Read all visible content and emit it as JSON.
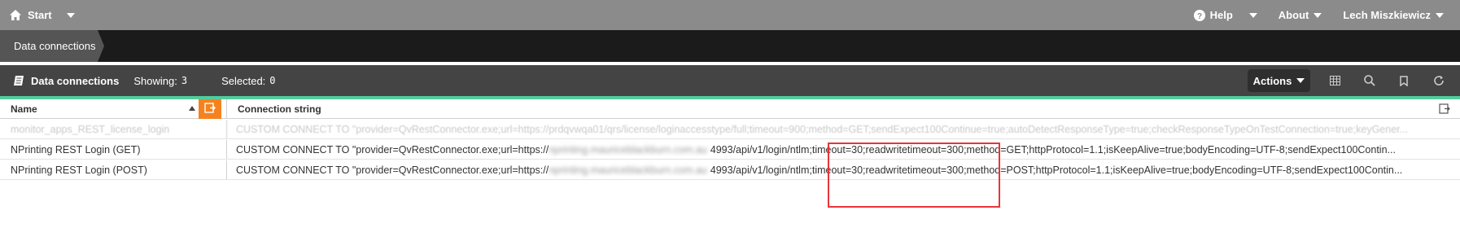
{
  "topbar": {
    "start_label": "Start",
    "help_label": "Help",
    "about_label": "About",
    "user_name": "Lech Miszkiewicz"
  },
  "breadcrumb": {
    "label": "Data connections"
  },
  "toolbar": {
    "title": "Data connections",
    "showing_label": "Showing:",
    "showing_count": "3",
    "selected_label": "Selected:",
    "selected_count": "0",
    "actions_label": "Actions"
  },
  "table": {
    "columns": {
      "name": "Name",
      "connection_string": "Connection string"
    },
    "rows": [
      {
        "name": "monitor_apps_REST_license_login",
        "conn_prefix": "CUSTOM CONNECT TO \"provider=QvRestConnector.exe;url=https://prdqvwqa01/qrs/license/loginaccesstype/full;timeout=900;method=GET;sendExpect100Continue=true;autoDetectResponseType=true;checkResponseTypeOnTestConnection=true;keyGener...",
        "conn_blur": "",
        "conn_suffix": ""
      },
      {
        "name": "NPrinting REST Login (GET)",
        "conn_prefix": "CUSTOM CONNECT TO \"provider=QvRestConnector.exe;url=https://",
        "conn_blur": "nprinting.mauriceblackburn.com.au",
        "conn_suffix": "4993/api/v1/login/ntlm;timeout=30;readwritetimeout=300;method=GET;httpProtocol=1.1;isKeepAlive=true;bodyEncoding=UTF-8;sendExpect100Contin..."
      },
      {
        "name": "NPrinting REST Login (POST)",
        "conn_prefix": "CUSTOM CONNECT TO \"provider=QvRestConnector.exe;url=https://",
        "conn_blur": "nprinting.mauriceblackburn.com.au",
        "conn_suffix": "4993/api/v1/login/ntlm;timeout=30;readwritetimeout=300;method=POST;httpProtocol=1.1;isKeepAlive=true;bodyEncoding=UTF-8;sendExpect100Contin..."
      }
    ]
  },
  "colors": {
    "topbar": "#8b8b8b",
    "breadcrumb_bar": "#1b1b1b",
    "toolbar": "#444444",
    "accent": "#52cc9c",
    "orange_button": "#f5821f",
    "highlight_box": "#e8353a"
  },
  "icons": {
    "start": "home-icon",
    "help": "help-icon",
    "toolbar_title": "data-connections-icon",
    "table_view": "table-view-icon",
    "search": "search-icon",
    "bookmark": "bookmark-icon",
    "refresh": "refresh-icon",
    "column_selector": "column-selector-icon",
    "column_menu": "column-menu-icon"
  }
}
